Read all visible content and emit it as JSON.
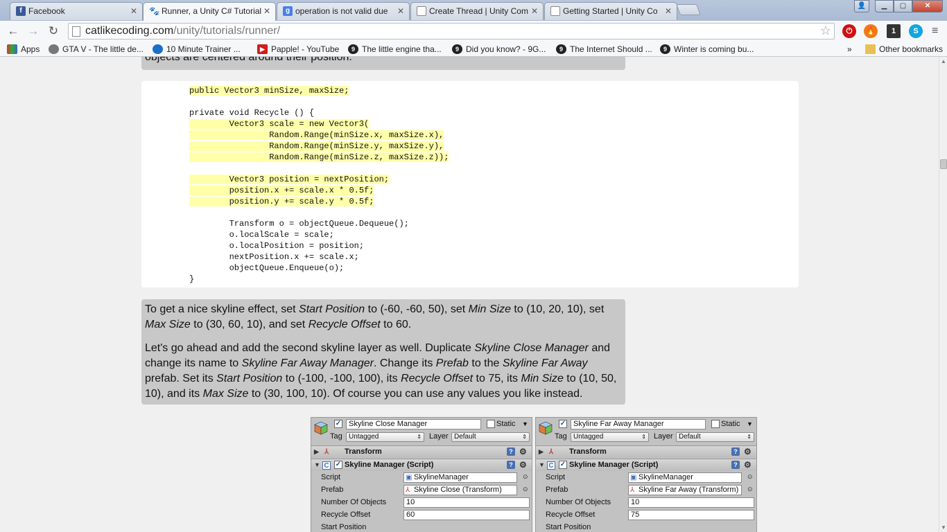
{
  "tabs": [
    {
      "label": "Facebook",
      "favicon": "facebook-icon",
      "active": false
    },
    {
      "label": "Runner, a Unity C# Tutorial",
      "favicon": "paw-icon",
      "active": true
    },
    {
      "label": "operation is not valid due",
      "favicon": "google-icon",
      "active": false
    },
    {
      "label": "Create Thread | Unity Com",
      "favicon": "page-icon",
      "active": false
    },
    {
      "label": "Getting Started | Unity Co",
      "favicon": "page-icon",
      "active": false
    }
  ],
  "address": {
    "host": "catlikecoding.com",
    "path": "/unity/tutorials/runner/"
  },
  "bookmarks": {
    "apps": "Apps",
    "items": [
      "GTA V - The little de...",
      "10 Minute Trainer ...",
      "Papple! - YouTube",
      "The little engine tha...",
      "Did you know? - 9G...",
      "The Internet Should ...",
      "Winter is coming bu..."
    ],
    "overflow": "»",
    "other": "Other bookmarks"
  },
  "article": {
    "top_note": "objects are centered around their position.",
    "code": [
      "public Vector3 minSize, maxSize;",
      "",
      "private void Recycle () {",
      "        Vector3 scale = new Vector3(",
      "                Random.Range(minSize.x, maxSize.x),",
      "                Random.Range(minSize.y, maxSize.y),",
      "                Random.Range(minSize.z, maxSize.z));",
      "",
      "        Vector3 position = nextPosition;",
      "        position.x += scale.x * 0.5f;",
      "        position.y += scale.y * 0.5f;",
      "",
      "        Transform o = objectQueue.Dequeue();",
      "        o.localScale = scale;",
      "        o.localPosition = position;",
      "        nextPosition.x += scale.x;",
      "        objectQueue.Enqueue(o);",
      "}"
    ],
    "para1": {
      "t1": "To get a nice skyline effect, set ",
      "i1": "Start Position",
      "t2": " to (-60, -60, 50), set ",
      "i2": "Min Size",
      "t3": " to (10, 20, 10), set ",
      "i3": "Max Size",
      "t4": " to (30, 60, 10), and set ",
      "i4": "Recycle Offset",
      "t5": " to 60."
    },
    "para2": {
      "t1": "Let's go ahead and add the second skyline layer as well. Duplicate ",
      "i1": "Skyline Close Manager",
      "t2": " and change its name to ",
      "i2": "Skyline Far Away Manager",
      "t3": ". Change its ",
      "i3": "Prefab",
      "t4": " to the ",
      "i4": "Skyline Far Away",
      "t5": " prefab. Set its ",
      "i5": "Start Position",
      "t6": " to (-100, -100, 100), its ",
      "i6": "Recycle Offset",
      "t7": " to 75, its ",
      "i7": "Min Size",
      "t8": " to (10, 50, 10), and its ",
      "i8": "Max Size",
      "t9": " to (30, 100, 10). Of course you can use any values you like instead."
    }
  },
  "inspector_labels": {
    "static": "Static",
    "tag": "Tag",
    "layer": "Layer",
    "tag_value": "Untagged",
    "layer_value": "Default",
    "transform": "Transform",
    "component": "Skyline Manager (Script)",
    "script": "Script",
    "prefab": "Prefab",
    "number_of_objects": "Number Of Objects",
    "recycle_offset": "Recycle Offset",
    "start_position": "Start Position"
  },
  "inspectors": [
    {
      "name": "Skyline Close Manager",
      "script": "SkylineManager",
      "prefab": "Skyline Close (Transform)",
      "number_of_objects": "10",
      "recycle_offset": "60"
    },
    {
      "name": "Skyline Far Away Manager",
      "script": "SkylineManager",
      "prefab": "Skyline Far Away (Transform)",
      "number_of_objects": "10",
      "recycle_offset": "75"
    }
  ],
  "colors": {
    "note_bg": "#c8c8c8",
    "code_highlight": "#ffffa8",
    "page_bg": "#f0f0f0"
  }
}
